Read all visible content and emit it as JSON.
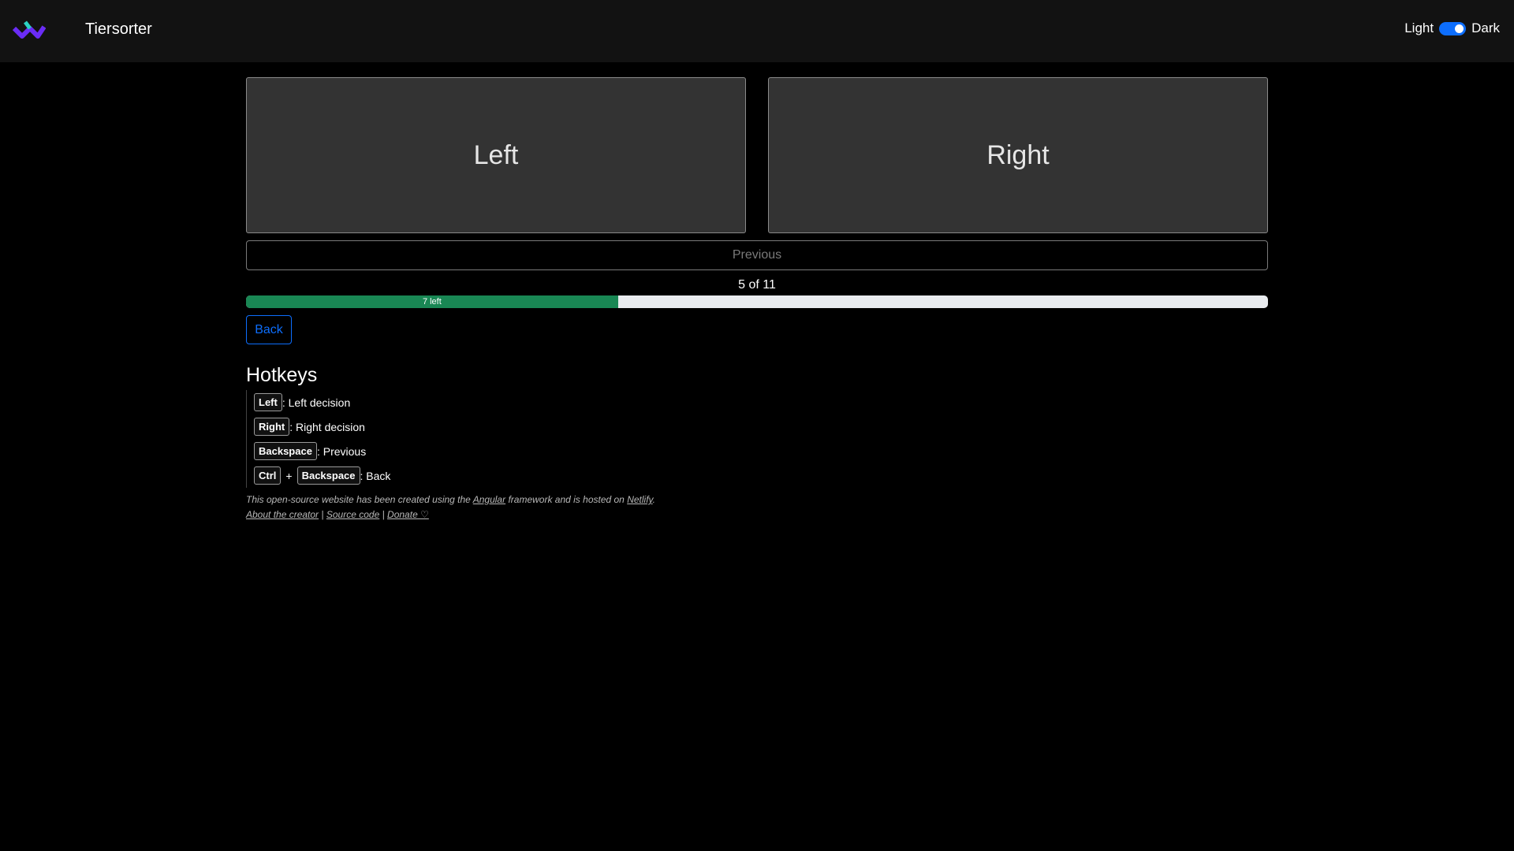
{
  "navbar": {
    "brand": "Tiersorter",
    "theme_light_label": "Light",
    "theme_dark_label": "Dark",
    "dark_mode_on": true
  },
  "comparison": {
    "left_label": "Left",
    "right_label": "Right",
    "previous_label": "Previous"
  },
  "progress": {
    "count_text": "5 of 11",
    "bar_text": "7 left",
    "fraction": 0.364
  },
  "back_label": "Back",
  "hotkeys": {
    "title": "Hotkeys",
    "items": [
      {
        "key": "Left",
        "desc": ": Left decision"
      },
      {
        "key": "Right",
        "desc": ": Right decision"
      },
      {
        "key": "Backspace",
        "desc": ": Previous"
      },
      {
        "key": "Ctrl",
        "plus": "+",
        "key2": "Backspace",
        "desc": ": Back"
      }
    ]
  },
  "footer": {
    "line1_a": "This open-source website has been created using the ",
    "angular_link": "Angular",
    "line1_b": " framework and is hosted on ",
    "netlify_link": "Netlify",
    "line1_c": ".",
    "about_link": "About the creator",
    "sep1": " | ",
    "source_link": "Source code",
    "sep2": " | ",
    "donate_link": "Donate ♡"
  },
  "colors": {
    "accent": "#0d6efd",
    "progress_fill": "#198754",
    "background": "#000000",
    "navbar": "#121212"
  }
}
